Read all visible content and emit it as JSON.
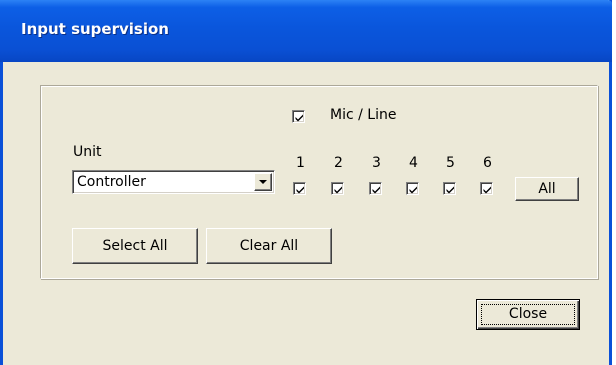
{
  "window": {
    "title": "Input supervision"
  },
  "mic_line": {
    "label": "Mic / Line",
    "checked": true
  },
  "unit": {
    "label": "Unit",
    "selected": "Controller"
  },
  "channels": [
    {
      "label": "1",
      "checked": true
    },
    {
      "label": "2",
      "checked": true
    },
    {
      "label": "3",
      "checked": true
    },
    {
      "label": "4",
      "checked": true
    },
    {
      "label": "5",
      "checked": true
    },
    {
      "label": "6",
      "checked": true
    }
  ],
  "buttons": {
    "all": "All",
    "select_all": "Select All",
    "clear_all": "Clear All",
    "close": "Close"
  },
  "colors": {
    "titlebar": "#0a56dc",
    "dialog_background": "#ece9d8"
  }
}
